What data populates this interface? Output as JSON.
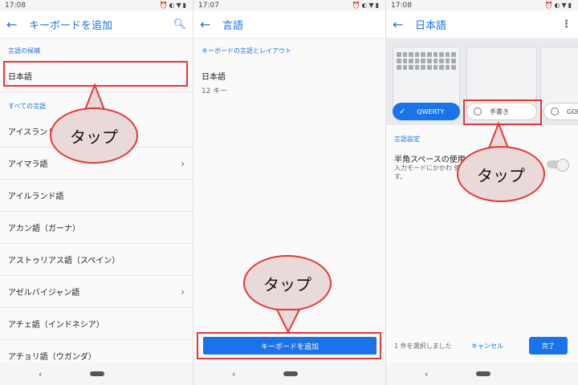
{
  "panel1": {
    "time": "17:08",
    "title": "キーボードを追加",
    "section_candidates": "言語の候補",
    "candidate": "日本語",
    "section_all": "すべての言語",
    "languages": [
      "アイスランド語",
      "アイマラ語",
      "アイルランド語",
      "アカン語（ガーナ）",
      "アストゥリアス語（スペイン）",
      "アゼルバイジャン語",
      "アチェ語（インドネシア）",
      "アチョリ語（ウガンダ）"
    ],
    "callout": "タップ"
  },
  "panel2": {
    "time": "17:07",
    "title": "言語",
    "section": "キーボードの言語とレイアウト",
    "language": "日本語",
    "keys": "12 キー",
    "add_button": "キーボードを追加",
    "callout": "タップ"
  },
  "panel3": {
    "time": "17:08",
    "title": "日本語",
    "chip_qwerty": "QWERTY",
    "chip_handwriting": "手書き",
    "chip_goda": "GODA",
    "section": "言語設定",
    "setting_title": "半角スペースの使用",
    "setting_desc": "入力モードにかかわ 使用します。",
    "selected_count": "1 件を選択しました",
    "cancel": "キャンセル",
    "done": "完了",
    "callout": "タップ"
  },
  "colors": {
    "accent": "#1a73e8",
    "highlight": "#e53935"
  }
}
